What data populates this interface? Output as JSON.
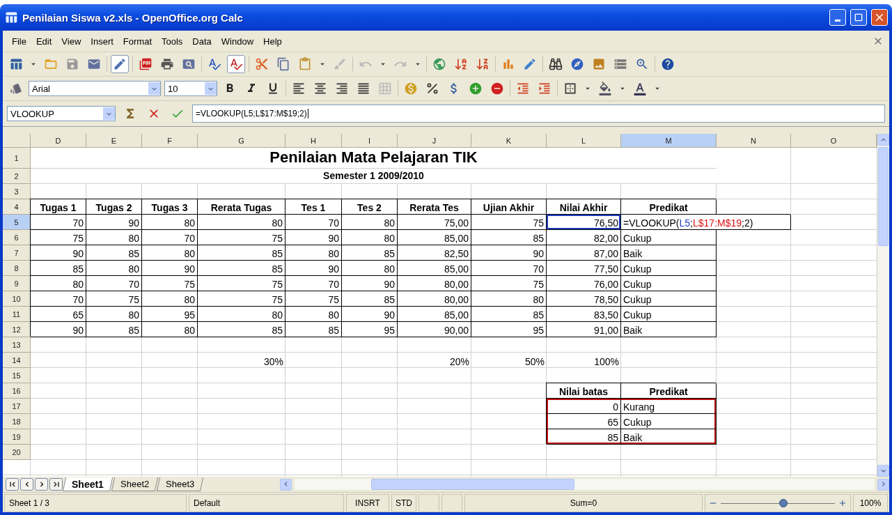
{
  "window": {
    "title": "Penilaian Siswa v2.xls - OpenOffice.org Calc"
  },
  "menu": [
    "File",
    "Edit",
    "View",
    "Insert",
    "Format",
    "Tools",
    "Data",
    "Window",
    "Help"
  ],
  "formatting": {
    "font": "Arial",
    "size": "10"
  },
  "formula_bar": {
    "name_box": "VLOOKUP",
    "formula": "=VLOOKUP(L5;L$17:M$19;2)"
  },
  "columns": [
    {
      "label": "D",
      "selected": false
    },
    {
      "label": "E",
      "selected": false
    },
    {
      "label": "F",
      "selected": false
    },
    {
      "label": "G",
      "selected": false
    },
    {
      "label": "H",
      "selected": false
    },
    {
      "label": "I",
      "selected": false
    },
    {
      "label": "J",
      "selected": false
    },
    {
      "label": "K",
      "selected": false
    },
    {
      "label": "L",
      "selected": false
    },
    {
      "label": "M",
      "selected": true
    },
    {
      "label": "N",
      "selected": false
    },
    {
      "label": "O",
      "selected": false
    }
  ],
  "rows": [
    {
      "label": "1",
      "selected": false,
      "cells": [
        {
          "kind": "title",
          "text": "Penilaian Mata Pelajaran TIK"
        }
      ]
    },
    {
      "label": "2",
      "selected": false,
      "cells": [
        {
          "kind": "subtitle",
          "text": "Semester 1 2009/2010"
        }
      ]
    },
    {
      "label": "3",
      "selected": false
    },
    {
      "label": "4",
      "selected": false,
      "cells": [
        {
          "kind": "header",
          "text": "Tugas 1"
        },
        {
          "kind": "header",
          "text": "Tugas 2"
        },
        {
          "kind": "header",
          "text": "Tugas 3"
        },
        {
          "kind": "header",
          "text": "Rerata Tugas"
        },
        {
          "kind": "header",
          "text": "Tes 1"
        },
        {
          "kind": "header",
          "text": "Tes 2"
        },
        {
          "kind": "header",
          "text": "Rerata Tes"
        },
        {
          "kind": "header",
          "text": "Ujian Akhir"
        },
        {
          "kind": "header",
          "text": "Nilai Akhir"
        },
        {
          "kind": "header",
          "text": "Predikat"
        }
      ]
    },
    {
      "label": "5",
      "selected": true,
      "cells": [
        {
          "kind": "number",
          "text": "70"
        },
        {
          "kind": "number",
          "text": "90"
        },
        {
          "kind": "number",
          "text": "80"
        },
        {
          "kind": "number",
          "text": "80"
        },
        {
          "kind": "number",
          "text": "70"
        },
        {
          "kind": "number",
          "text": "80"
        },
        {
          "kind": "number",
          "text": "75,00"
        },
        {
          "kind": "number",
          "text": "75"
        },
        {
          "kind": "number",
          "text": "76,50",
          "color": "#1f3fbf"
        },
        {
          "kind": "formula",
          "segments": [
            {
              "text": "=VLOOKUP("
            },
            {
              "text": "L5",
              "color": "#1f3fbf"
            },
            {
              "text": ";"
            },
            {
              "text": "L$17:M$19",
              "color": "#e01010"
            },
            {
              "text": ";2)"
            }
          ]
        }
      ]
    },
    {
      "label": "6",
      "selected": false,
      "cells": [
        {
          "kind": "number",
          "text": "75"
        },
        {
          "kind": "number",
          "text": "80"
        },
        {
          "kind": "number",
          "text": "70"
        },
        {
          "kind": "number",
          "text": "75"
        },
        {
          "kind": "number",
          "text": "90"
        },
        {
          "kind": "number",
          "text": "80"
        },
        {
          "kind": "number",
          "text": "85,00"
        },
        {
          "kind": "number",
          "text": "85"
        },
        {
          "kind": "number",
          "text": "82,00"
        },
        {
          "kind": "label",
          "text": "Cukup"
        }
      ]
    },
    {
      "label": "7",
      "selected": false,
      "cells": [
        {
          "kind": "number",
          "text": "90"
        },
        {
          "kind": "number",
          "text": "85"
        },
        {
          "kind": "number",
          "text": "80"
        },
        {
          "kind": "number",
          "text": "85"
        },
        {
          "kind": "number",
          "text": "80"
        },
        {
          "kind": "number",
          "text": "85"
        },
        {
          "kind": "number",
          "text": "82,50"
        },
        {
          "kind": "number",
          "text": "90"
        },
        {
          "kind": "number",
          "text": "87,00"
        },
        {
          "kind": "label",
          "text": "Baik"
        }
      ]
    },
    {
      "label": "8",
      "selected": false,
      "cells": [
        {
          "kind": "number",
          "text": "85"
        },
        {
          "kind": "number",
          "text": "80"
        },
        {
          "kind": "number",
          "text": "90"
        },
        {
          "kind": "number",
          "text": "85"
        },
        {
          "kind": "number",
          "text": "90"
        },
        {
          "kind": "number",
          "text": "80"
        },
        {
          "kind": "number",
          "text": "85,00"
        },
        {
          "kind": "number",
          "text": "70"
        },
        {
          "kind": "number",
          "text": "77,50"
        },
        {
          "kind": "label",
          "text": "Cukup"
        }
      ]
    },
    {
      "label": "9",
      "selected": false,
      "cells": [
        {
          "kind": "number",
          "text": "80"
        },
        {
          "kind": "number",
          "text": "70"
        },
        {
          "kind": "number",
          "text": "75"
        },
        {
          "kind": "number",
          "text": "75"
        },
        {
          "kind": "number",
          "text": "70"
        },
        {
          "kind": "number",
          "text": "90"
        },
        {
          "kind": "number",
          "text": "80,00"
        },
        {
          "kind": "number",
          "text": "75"
        },
        {
          "kind": "number",
          "text": "76,00"
        },
        {
          "kind": "label",
          "text": "Cukup"
        }
      ]
    },
    {
      "label": "10",
      "selected": false,
      "cells": [
        {
          "kind": "number",
          "text": "70"
        },
        {
          "kind": "number",
          "text": "75"
        },
        {
          "kind": "number",
          "text": "80"
        },
        {
          "kind": "number",
          "text": "75"
        },
        {
          "kind": "number",
          "text": "75"
        },
        {
          "kind": "number",
          "text": "85"
        },
        {
          "kind": "number",
          "text": "80,00"
        },
        {
          "kind": "number",
          "text": "80"
        },
        {
          "kind": "number",
          "text": "78,50"
        },
        {
          "kind": "label",
          "text": "Cukup"
        }
      ]
    },
    {
      "label": "11",
      "selected": false,
      "cells": [
        {
          "kind": "number",
          "text": "65"
        },
        {
          "kind": "number",
          "text": "80"
        },
        {
          "kind": "number",
          "text": "95"
        },
        {
          "kind": "number",
          "text": "80"
        },
        {
          "kind": "number",
          "text": "80"
        },
        {
          "kind": "number",
          "text": "90"
        },
        {
          "kind": "number",
          "text": "85,00"
        },
        {
          "kind": "number",
          "text": "85"
        },
        {
          "kind": "number",
          "text": "83,50"
        },
        {
          "kind": "label",
          "text": "Cukup"
        }
      ]
    },
    {
      "label": "12",
      "selected": false,
      "cells": [
        {
          "kind": "number",
          "text": "90"
        },
        {
          "kind": "number",
          "text": "85"
        },
        {
          "kind": "number",
          "text": "80"
        },
        {
          "kind": "number",
          "text": "85"
        },
        {
          "kind": "number",
          "text": "85"
        },
        {
          "kind": "number",
          "text": "95"
        },
        {
          "kind": "number",
          "text": "90,00"
        },
        {
          "kind": "number",
          "text": "95"
        },
        {
          "kind": "number",
          "text": "91,00"
        },
        {
          "kind": "label",
          "text": "Baik"
        }
      ]
    },
    {
      "label": "13",
      "selected": false
    },
    {
      "label": "14",
      "selected": false,
      "cells": [
        {
          "kind": "empty"
        },
        {
          "kind": "empty"
        },
        {
          "kind": "empty"
        },
        {
          "kind": "plain",
          "text": "30%"
        },
        {
          "kind": "empty"
        },
        {
          "kind": "empty"
        },
        {
          "kind": "plain",
          "text": "20%"
        },
        {
          "kind": "plain",
          "text": "50%"
        },
        {
          "kind": "plain",
          "text": "100%"
        }
      ]
    },
    {
      "label": "15",
      "selected": false
    },
    {
      "label": "16",
      "selected": false,
      "cells": [
        {
          "kind": "empty"
        },
        {
          "kind": "empty"
        },
        {
          "kind": "empty"
        },
        {
          "kind": "empty"
        },
        {
          "kind": "empty"
        },
        {
          "kind": "empty"
        },
        {
          "kind": "empty"
        },
        {
          "kind": "empty"
        },
        {
          "kind": "header",
          "text": "Nilai batas"
        },
        {
          "kind": "header",
          "text": "Predikat"
        }
      ]
    },
    {
      "label": "17",
      "selected": false,
      "cells": [
        {
          "kind": "empty"
        },
        {
          "kind": "empty"
        },
        {
          "kind": "empty"
        },
        {
          "kind": "empty"
        },
        {
          "kind": "empty"
        },
        {
          "kind": "empty"
        },
        {
          "kind": "empty"
        },
        {
          "kind": "empty"
        },
        {
          "kind": "number",
          "text": "0",
          "color": "#c01010"
        },
        {
          "kind": "label",
          "text": "Kurang",
          "color": "#c01010"
        }
      ]
    },
    {
      "label": "18",
      "selected": false,
      "cells": [
        {
          "kind": "empty"
        },
        {
          "kind": "empty"
        },
        {
          "kind": "empty"
        },
        {
          "kind": "empty"
        },
        {
          "kind": "empty"
        },
        {
          "kind": "empty"
        },
        {
          "kind": "empty"
        },
        {
          "kind": "empty"
        },
        {
          "kind": "number",
          "text": "65",
          "color": "#c01010"
        },
        {
          "kind": "label",
          "text": "Cukup",
          "color": "#c01010"
        }
      ]
    },
    {
      "label": "19",
      "selected": false,
      "cells": [
        {
          "kind": "empty"
        },
        {
          "kind": "empty"
        },
        {
          "kind": "empty"
        },
        {
          "kind": "empty"
        },
        {
          "kind": "empty"
        },
        {
          "kind": "empty"
        },
        {
          "kind": "empty"
        },
        {
          "kind": "empty"
        },
        {
          "kind": "number",
          "text": "85",
          "color": "#c01010"
        },
        {
          "kind": "label",
          "text": "Baik",
          "color": "#c01010"
        }
      ]
    },
    {
      "label": "20",
      "selected": false
    }
  ],
  "sheet_tabs": [
    {
      "label": "Sheet1",
      "selected": true
    },
    {
      "label": "Sheet2",
      "selected": false
    },
    {
      "label": "Sheet3",
      "selected": false
    }
  ],
  "status_bar": {
    "sheet": "Sheet 1 / 3",
    "style": "Default",
    "mode": "INSRT",
    "selection_mode": "STD",
    "sum": "Sum=0",
    "zoom_slider": {
      "level": 0.55
    },
    "zoom": "100%"
  }
}
